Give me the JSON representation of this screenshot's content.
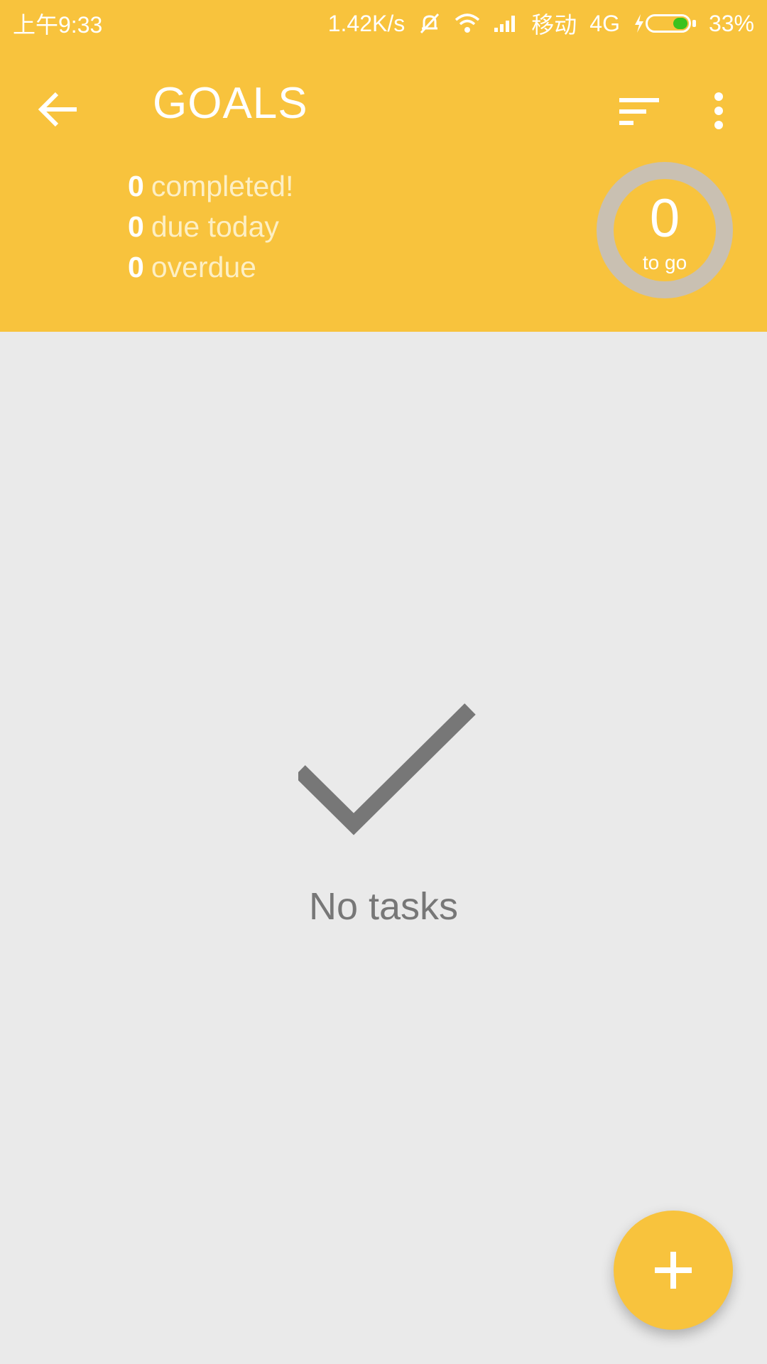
{
  "status_bar": {
    "time": "上午9:33",
    "speed": "1.42K/s",
    "carrier": "移动",
    "network": "4G",
    "battery": "33%",
    "battery_level": 0.33,
    "icons": [
      "mute-icon",
      "wifi-icon",
      "signal-icon",
      "charging-icon",
      "battery-icon"
    ]
  },
  "app_bar": {
    "title": "GOALS",
    "icons": [
      "back-arrow-icon",
      "sort-icon",
      "more-vert-icon"
    ]
  },
  "summary": {
    "completed": {
      "count": "0",
      "label": "completed!"
    },
    "due_today": {
      "count": "0",
      "label": "due today"
    },
    "overdue": {
      "count": "0",
      "label": "overdue"
    }
  },
  "ring": {
    "count": "0",
    "label": "to go"
  },
  "empty_state": {
    "icon": "checkmark-icon",
    "text": "No tasks"
  },
  "fab": {
    "icon": "plus-icon"
  },
  "colors": {
    "primary": "#F8C33D",
    "background": "#EAEAEA",
    "ring": "#C9C0B2",
    "empty_text": "#777777",
    "battery_fill": "#3BC21E"
  }
}
